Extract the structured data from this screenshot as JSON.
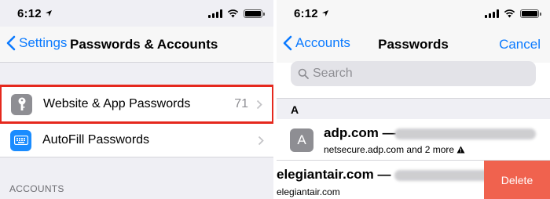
{
  "left": {
    "status": {
      "time": "6:12"
    },
    "nav": {
      "back_label": "Settings",
      "title": "Passwords & Accounts"
    },
    "items": [
      {
        "label": "Website & App Passwords",
        "value": "71",
        "icon": "key-icon"
      },
      {
        "label": "AutoFill Passwords",
        "value": "",
        "icon": "keyboard-icon"
      }
    ],
    "section_header": "ACCOUNTS"
  },
  "right": {
    "status": {
      "time": "6:12"
    },
    "nav": {
      "back_label": "Accounts",
      "title": "Passwords",
      "cancel_label": "Cancel"
    },
    "search": {
      "placeholder": "Search"
    },
    "section": "A",
    "rows": [
      {
        "avatar": "A",
        "title": "adp.com —",
        "subtitle": "netsecure.adp.com and 2 more"
      },
      {
        "title": "elegiantair.com —",
        "subtitle": "elegiantair.com",
        "action": "Delete"
      }
    ]
  },
  "colors": {
    "accent": "#0a7aff",
    "highlight": "#e5281d",
    "delete": "#f0624e"
  }
}
